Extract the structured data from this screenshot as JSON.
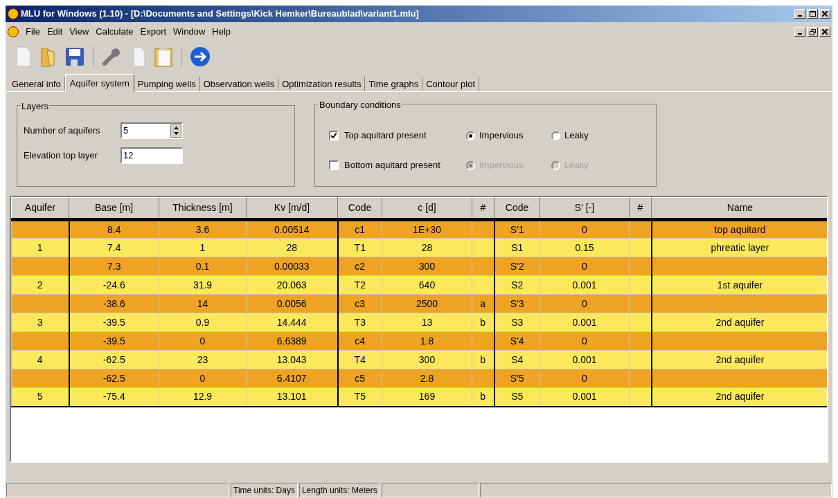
{
  "window": {
    "title": "MLU for Windows (1.10) - [D:\\Documents and Settings\\Kick Hemker\\Bureaublad\\variant1.mlu]"
  },
  "menu": [
    "File",
    "Edit",
    "View",
    "Calculate",
    "Export",
    "Window",
    "Help"
  ],
  "tabs": [
    {
      "label": "General info",
      "selected": false
    },
    {
      "label": "Aquifer system",
      "selected": true
    },
    {
      "label": "Pumping wells",
      "selected": false
    },
    {
      "label": "Observation wells",
      "selected": false
    },
    {
      "label": "Optimization results",
      "selected": false
    },
    {
      "label": "Time graphs",
      "selected": false
    },
    {
      "label": "Contour plot",
      "selected": false
    }
  ],
  "layers": {
    "title": "Layers",
    "number_of_aquifers": {
      "label": "Number of aquifers",
      "value": "5"
    },
    "elevation_top_layer": {
      "label": "Elevation top layer",
      "value": "12"
    }
  },
  "boundary": {
    "title": "Boundary conditions",
    "rows": [
      {
        "label": "Top aquitard present",
        "checked": true,
        "disabled": false,
        "options": [
          {
            "label": "Impervious",
            "selected": true
          },
          {
            "label": "Leaky",
            "selected": false
          }
        ]
      },
      {
        "label": "Bottom aquitard present",
        "checked": false,
        "disabled": true,
        "options": [
          {
            "label": "Impervious",
            "selected": true
          },
          {
            "label": "Leaky",
            "selected": false
          }
        ]
      }
    ]
  },
  "table": {
    "columns": [
      "Aquifer",
      "Base [m]",
      "Thickness [m]",
      "Kv [m/d]",
      "Code",
      "c [d]",
      "#",
      "Code",
      "S' [-]",
      "#",
      "Name"
    ],
    "rows": [
      {
        "kind": "aquitard",
        "cells": [
          "",
          "8.4",
          "3.6",
          "0.00514",
          "c1",
          "1E+30",
          "",
          "S'1",
          "0",
          "",
          "top aquitard"
        ]
      },
      {
        "kind": "aquifer",
        "cells": [
          "1",
          "7.4",
          "1",
          "28",
          "T1",
          "28",
          "",
          "S1",
          "0.15",
          "",
          "phreatic layer"
        ]
      },
      {
        "kind": "aquitard",
        "cells": [
          "",
          "7.3",
          "0.1",
          "0.00033",
          "c2",
          "300",
          "",
          "S'2",
          "0",
          "",
          ""
        ]
      },
      {
        "kind": "aquifer",
        "cells": [
          "2",
          "-24.6",
          "31.9",
          "20.063",
          "T2",
          "640",
          "",
          "S2",
          "0.001",
          "",
          "1st aquifer"
        ]
      },
      {
        "kind": "aquitard",
        "cells": [
          "",
          "-38.6",
          "14",
          "0.0056",
          "c3",
          "2500",
          "a",
          "S'3",
          "0",
          "",
          ""
        ]
      },
      {
        "kind": "aquifer",
        "cells": [
          "3",
          "-39.5",
          "0.9",
          "14.444",
          "T3",
          "13",
          "b",
          "S3",
          "0.001",
          "",
          "2nd aquifer"
        ]
      },
      {
        "kind": "aquitard",
        "cells": [
          "",
          "-39.5",
          "0",
          "6.6389",
          "c4",
          "1.8",
          "",
          "S'4",
          "0",
          "",
          ""
        ]
      },
      {
        "kind": "aquifer",
        "cells": [
          "4",
          "-62.5",
          "23",
          "13.043",
          "T4",
          "300",
          "b",
          "S4",
          "0.001",
          "",
          "2nd aquifer"
        ]
      },
      {
        "kind": "aquitard",
        "cells": [
          "",
          "-62.5",
          "0",
          "6.4107",
          "c5",
          "2.8",
          "",
          "S'5",
          "0",
          "",
          ""
        ]
      },
      {
        "kind": "aquifer",
        "cells": [
          "5",
          "-75.4",
          "12.9",
          "13.101",
          "T5",
          "169",
          "b",
          "S5",
          "0.001",
          "",
          "2nd aquifer"
        ]
      }
    ]
  },
  "status_bar": [
    "Time units: Days",
    "Length units: Meters"
  ]
}
